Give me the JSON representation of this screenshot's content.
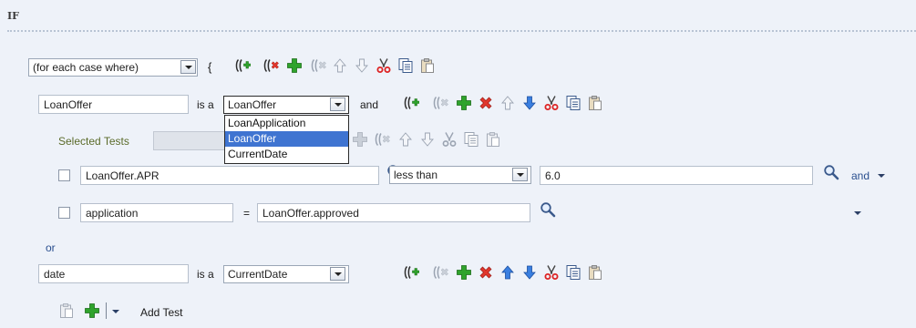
{
  "header": {
    "if_label": "IF"
  },
  "row_for_each": {
    "selector_value": "(for each case where)",
    "brace": "{"
  },
  "row_loanoffer": {
    "var_value": "LoanOffer",
    "is_a": "is a",
    "type_value": "LoanOffer",
    "and_label": "and"
  },
  "type_dropdown": {
    "options": [
      "LoanApplication",
      "LoanOffer",
      "CurrentDate"
    ],
    "selected": "LoanOffer"
  },
  "selected_tests": {
    "label": "Selected Tests"
  },
  "test1": {
    "left_value": "LoanOffer.APR",
    "operator_value": "less than",
    "right_value": "6.0",
    "conj_label": "and"
  },
  "test2": {
    "left_value": "application",
    "operator_symbol": "=",
    "right_value": "LoanOffer.approved"
  },
  "or_label": "or",
  "row_date": {
    "var_value": "date",
    "is_a": "is a",
    "type_value": "CurrentDate"
  },
  "bottom": {
    "add_test_label": "Add Test"
  },
  "colors": {
    "background": "#eef2f9",
    "selected_option": "#3f74d1",
    "label_blue": "#2a4f8f",
    "label_olive": "#5b6b2a"
  },
  "icons": [
    "insert-condition-icon",
    "delete-condition-icon",
    "add-icon",
    "delete-icon",
    "move-up-icon",
    "move-down-icon",
    "cut-icon",
    "copy-icon",
    "paste-icon",
    "search-icon",
    "dropdown-arrow-icon"
  ]
}
